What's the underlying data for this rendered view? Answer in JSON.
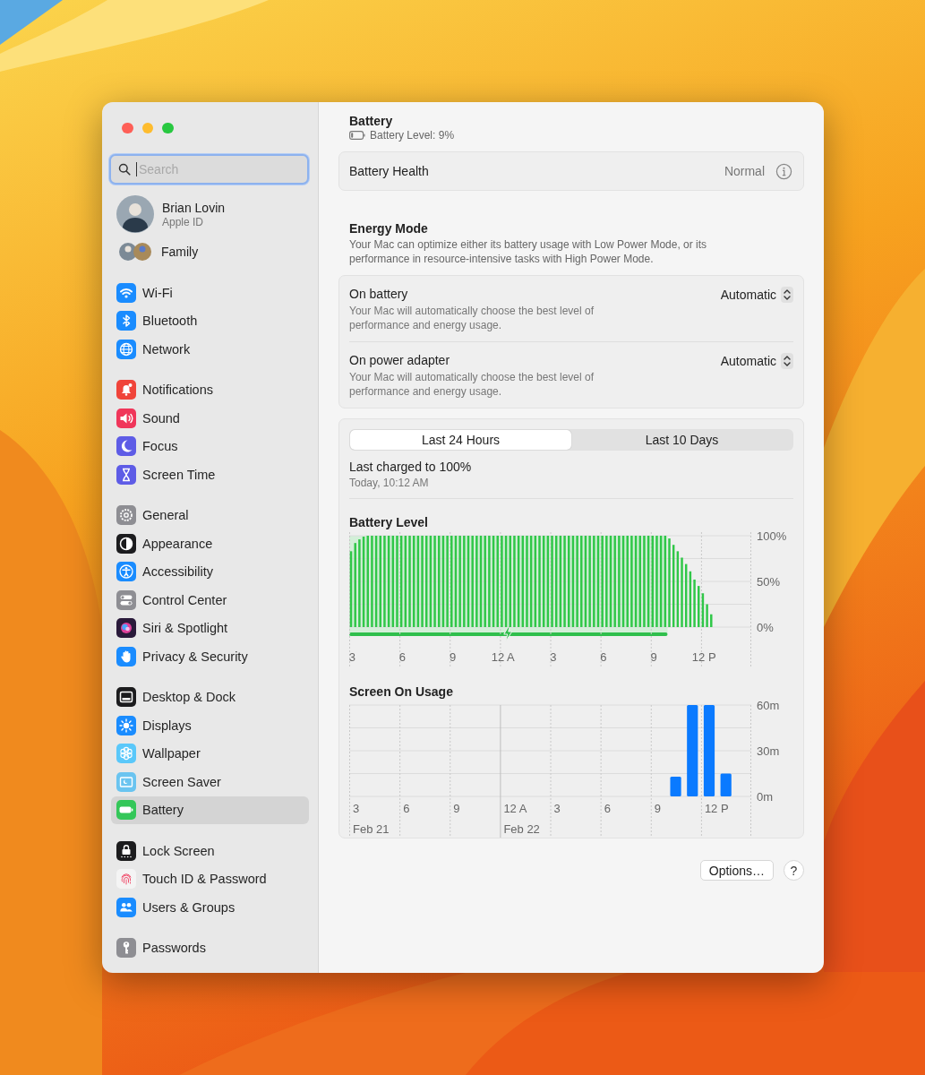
{
  "sidebar": {
    "search": {
      "placeholder": "Search",
      "focused": true
    },
    "account": {
      "name": "Brian Lovin",
      "subtitle": "Apple ID"
    },
    "family": {
      "label": "Family"
    },
    "groups": [
      {
        "items": [
          {
            "label": "Wi-Fi",
            "kind": "wifi",
            "color": "#1a8cff",
            "selected": false
          },
          {
            "label": "Bluetooth",
            "kind": "bluetooth",
            "color": "#1a8cff",
            "selected": false
          },
          {
            "label": "Network",
            "kind": "globe",
            "color": "#1a8cff",
            "selected": false
          }
        ]
      },
      {
        "items": [
          {
            "label": "Notifications",
            "kind": "bell",
            "color": "#f0443a",
            "selected": false
          },
          {
            "label": "Sound",
            "kind": "speaker",
            "color": "#f0365a",
            "selected": false
          },
          {
            "label": "Focus",
            "kind": "moon",
            "color": "#5e5ce6",
            "selected": false
          },
          {
            "label": "Screen Time",
            "kind": "hourglass",
            "color": "#5e5ce6",
            "selected": false
          }
        ]
      },
      {
        "items": [
          {
            "label": "General",
            "kind": "gear",
            "color": "#8e8e93",
            "selected": false
          },
          {
            "label": "Appearance",
            "kind": "contrast",
            "color": "#1c1c1e",
            "selected": false
          },
          {
            "label": "Accessibility",
            "kind": "person",
            "color": "#1a8cff",
            "selected": false
          },
          {
            "label": "Control Center",
            "kind": "toggles",
            "color": "#8e8e93",
            "selected": false
          },
          {
            "label": "Siri & Spotlight",
            "kind": "orb",
            "color": "#2a1a3a",
            "selected": false
          },
          {
            "label": "Privacy & Security",
            "kind": "hand",
            "color": "#1a8cff",
            "selected": false
          }
        ]
      },
      {
        "items": [
          {
            "label": "Desktop & Dock",
            "kind": "dock",
            "color": "#1c1c1e",
            "selected": false
          },
          {
            "label": "Displays",
            "kind": "sun",
            "color": "#1a8cff",
            "selected": false
          },
          {
            "label": "Wallpaper",
            "kind": "flower",
            "color": "#5ac8fa",
            "selected": false
          },
          {
            "label": "Screen Saver",
            "kind": "screensaver",
            "color": "#6ac4f0",
            "selected": false
          },
          {
            "label": "Battery",
            "kind": "battery",
            "color": "#34c759",
            "selected": true
          }
        ]
      },
      {
        "items": [
          {
            "label": "Lock Screen",
            "kind": "lock",
            "color": "#1c1c1e",
            "selected": false
          },
          {
            "label": "Touch ID & Password",
            "kind": "fingerprint",
            "color": "#f4f4f4",
            "selected": false
          },
          {
            "label": "Users & Groups",
            "kind": "people",
            "color": "#1a8cff",
            "selected": false
          }
        ]
      },
      {
        "items": [
          {
            "label": "Passwords",
            "kind": "key",
            "color": "#8e8e93",
            "selected": false
          }
        ]
      }
    ]
  },
  "header": {
    "title": "Battery",
    "subtitle": "Battery Level: 9%"
  },
  "health": {
    "label": "Battery Health",
    "value": "Normal"
  },
  "energy_mode": {
    "title": "Energy Mode",
    "description": "Your Mac can optimize either its battery usage with Low Power Mode, or its performance in resource-intensive tasks with High Power Mode.",
    "rows": [
      {
        "label": "On battery",
        "description": "Your Mac will automatically choose the best level of performance and energy usage.",
        "value": "Automatic"
      },
      {
        "label": "On power adapter",
        "description": "Your Mac will automatically choose the best level of performance and energy usage.",
        "value": "Automatic"
      }
    ]
  },
  "usage": {
    "tabs": [
      {
        "label": "Last 24 Hours",
        "selected": true
      },
      {
        "label": "Last 10 Days",
        "selected": false
      }
    ],
    "last_charged": "Last charged to 100%",
    "last_charged_time": "Today, 10:12 AM",
    "battery_level": {
      "chart_data": {
        "type": "bar",
        "title": "Battery Level",
        "ylim": [
          0,
          100
        ],
        "yticks": [
          {
            "value": 0,
            "label": "0%"
          },
          {
            "value": 50,
            "label": "50%"
          },
          {
            "value": 100,
            "label": "100%"
          }
        ],
        "categories": [
          "3",
          null,
          null,
          null,
          null,
          null,
          null,
          null,
          null,
          null,
          null,
          null,
          "6",
          null,
          null,
          null,
          null,
          null,
          null,
          null,
          null,
          null,
          null,
          null,
          "9",
          null,
          null,
          null,
          null,
          null,
          null,
          null,
          null,
          null,
          null,
          null,
          "12 A",
          null,
          null,
          null,
          null,
          null,
          null,
          null,
          null,
          null,
          null,
          null,
          "3",
          null,
          null,
          null,
          null,
          null,
          null,
          null,
          null,
          null,
          null,
          null,
          "6",
          null,
          null,
          null,
          null,
          null,
          null,
          null,
          null,
          null,
          null,
          null,
          "9",
          null,
          null,
          null,
          null,
          null,
          null,
          null,
          null,
          null,
          null,
          null,
          "12 P",
          null,
          null,
          null,
          null,
          null,
          null,
          null,
          null,
          null,
          null,
          null
        ],
        "series": [
          {
            "color": "#30c748",
            "values": [
              83,
              92,
              96,
              99,
              100,
              100,
              100,
              100,
              100,
              100,
              100,
              100,
              100,
              100,
              100,
              100,
              100,
              100,
              100,
              100,
              100,
              100,
              100,
              100,
              100,
              100,
              100,
              100,
              100,
              100,
              100,
              100,
              100,
              100,
              100,
              100,
              100,
              100,
              100,
              100,
              100,
              100,
              100,
              100,
              100,
              100,
              100,
              100,
              100,
              100,
              100,
              100,
              100,
              100,
              100,
              100,
              100,
              100,
              100,
              100,
              100,
              100,
              100,
              100,
              100,
              100,
              100,
              100,
              100,
              100,
              100,
              100,
              100,
              100,
              100,
              100,
              97,
              90,
              83,
              76,
              69,
              61,
              52,
              45,
              37,
              25,
              14,
              null,
              null,
              null,
              null,
              null,
              null,
              null,
              null,
              null
            ]
          }
        ]
      }
    },
    "screen_on_usage": {
      "chart_data": {
        "type": "bar",
        "title": "Screen On Usage",
        "ylim": [
          0,
          60
        ],
        "yticks": [
          {
            "value": 0,
            "label": "0m"
          },
          {
            "value": 30,
            "label": "30m"
          },
          {
            "value": 60,
            "label": "60m"
          }
        ],
        "categories": [
          "3",
          null,
          null,
          "6",
          null,
          null,
          "9",
          null,
          null,
          "12 A",
          null,
          null,
          "3",
          null,
          null,
          "6",
          null,
          null,
          "9",
          null,
          null,
          "12 P",
          null,
          null
        ],
        "series": [
          {
            "color": "#0a7aff",
            "values": [
              0,
              0,
              0,
              0,
              0,
              0,
              0,
              0,
              0,
              0,
              0,
              0,
              0,
              0,
              0,
              0,
              0,
              0,
              0,
              13,
              60,
              60,
              15,
              0
            ]
          }
        ]
      },
      "date_labels": [
        "Feb 21",
        "Feb 22"
      ]
    }
  },
  "buttons": {
    "options": "Options…",
    "help": "?"
  }
}
